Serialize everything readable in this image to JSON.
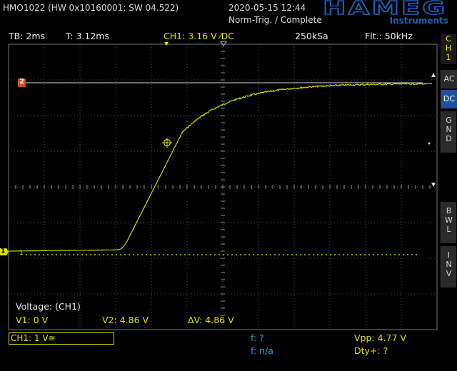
{
  "header": {
    "device": "HMO1022 (HW 0x10160001; SW 04.522)",
    "datetime": "2020-05-15 12:44",
    "trigger_status": "Norm-Trig. / Complete"
  },
  "logo": {
    "brand": "HAMEG",
    "sub": "Instruments"
  },
  "toolbar": {
    "timebase": "TB: 2ms",
    "trigger_time": "T: 3.12ms",
    "channel": "CH1: 3.16 V ⁄DC",
    "sample_rate": "250kSa",
    "filter": "Flt.: 50kHz"
  },
  "side_menu": {
    "channel_indicator": [
      "C",
      "H",
      "1"
    ],
    "ac": "AC",
    "dc": "DC",
    "gnd": [
      "G",
      "N",
      "D"
    ],
    "bwl": [
      "B",
      "W",
      "L"
    ],
    "inv": [
      "I",
      "N",
      "V"
    ]
  },
  "markers": {
    "reference": "2",
    "channel1_left": "1",
    "channel1_inner": "1"
  },
  "cursor_readout": {
    "label": "Voltage: (CH1)",
    "v1": "V1: 0 V",
    "v2": "V2: 4.86 V",
    "dv": "ΔV: 4.86 V"
  },
  "bottom": {
    "ch1_setting": "CH1: 1 V≅",
    "freq": "f: ?",
    "freq2": "f: n/a",
    "vpp": "Vpp: 4.77 V",
    "duty": "Dty+: ?"
  },
  "colors": {
    "trace": "#d6d600",
    "accent": "#1e4fa0",
    "cyan": "#2aa7d8"
  }
}
